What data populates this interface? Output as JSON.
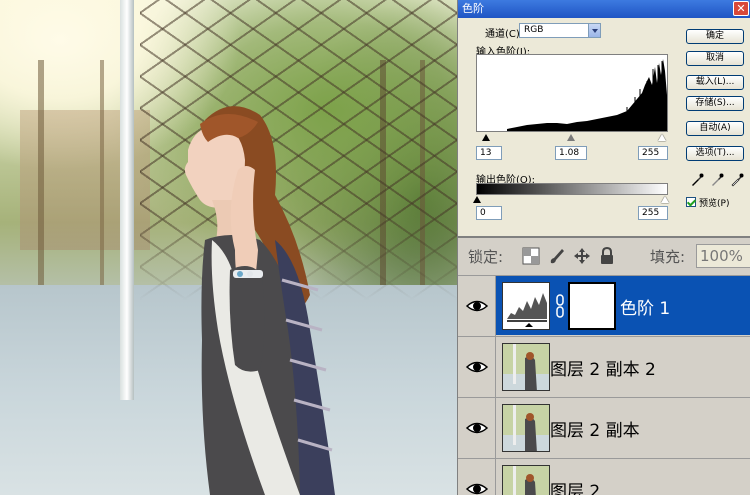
{
  "dialog": {
    "title": "色阶",
    "channel_label": "通道(C):",
    "channel_value": "RGB",
    "input_levels_label": "输入色阶(I):",
    "input_black": "13",
    "input_gamma": "1.08",
    "input_white": "255",
    "output_levels_label": "输出色阶(O):",
    "output_black": "0",
    "output_white": "255",
    "buttons": {
      "ok": "确定",
      "cancel": "取消",
      "load": "载入(L)...",
      "save": "存储(S)...",
      "auto": "自动(A)",
      "options": "选项(T)..."
    },
    "preview_label": "预览(P)",
    "preview_checked": true
  },
  "layers": {
    "lock_label": "锁定:",
    "fill_label": "填充:",
    "fill_value": "100%",
    "items": [
      {
        "name": "色阶 1",
        "active": true,
        "type": "adjustment"
      },
      {
        "name": "图层 2 副本 2",
        "active": false,
        "type": "image"
      },
      {
        "name": "图层 2 副本",
        "active": false,
        "type": "image"
      },
      {
        "name": "图层 2",
        "active": false,
        "type": "image"
      }
    ]
  },
  "icons": {
    "close": "close-icon",
    "dropdown": "chevron-down-icon",
    "eyedroppers": [
      "black-eyedropper-icon",
      "gray-eyedropper-icon",
      "white-eyedropper-icon"
    ],
    "lock_icons": [
      "lock-transparency-icon",
      "lock-paint-icon",
      "lock-position-icon",
      "lock-all-icon"
    ],
    "visibility": "eye-icon",
    "link": "chain-icon"
  },
  "colors": {
    "titlebar": "#2563d4",
    "active_layer": "#0a52b3",
    "panel_bg": "#d4d0c8"
  }
}
